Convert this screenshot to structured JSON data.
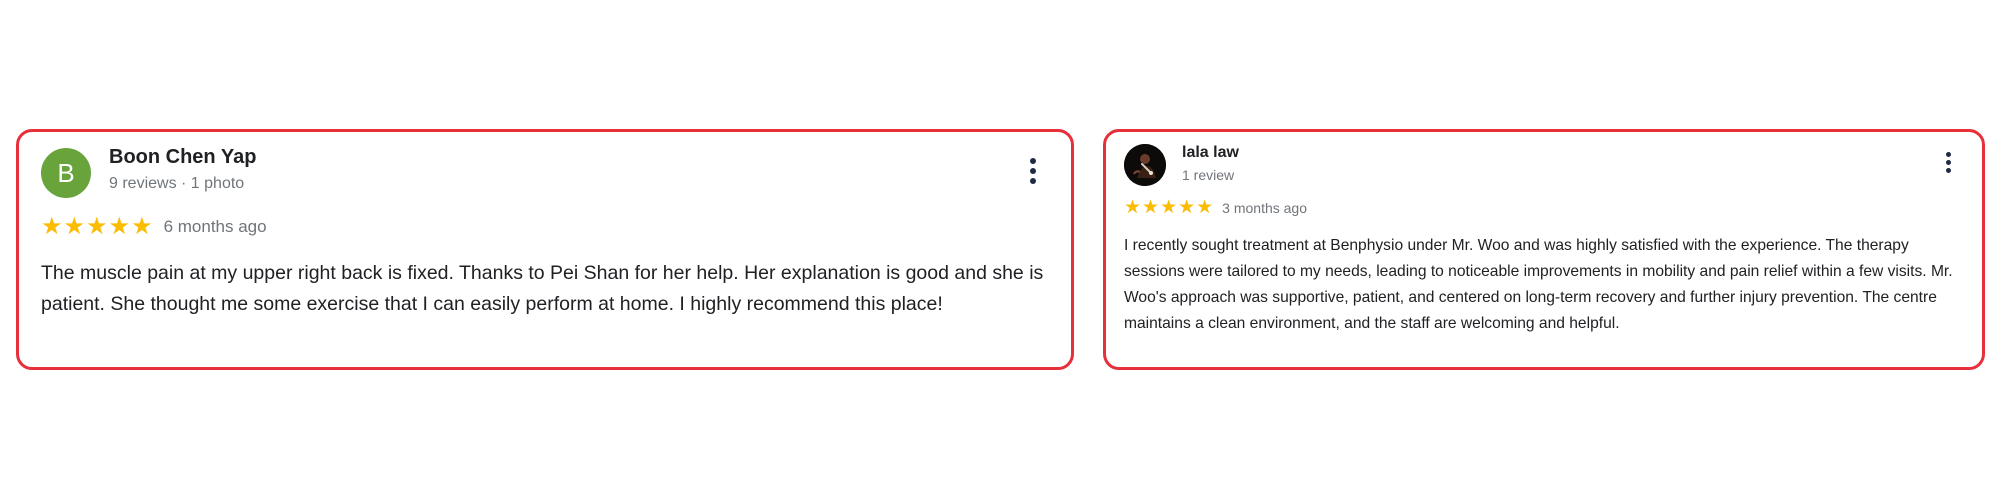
{
  "reviews": [
    {
      "avatar_letter": "B",
      "avatar_color": "#68a33c",
      "name": "Boon Chen Yap",
      "meta": "9 reviews · 1 photo",
      "rating": 5,
      "stars": "★★★★★",
      "date": "6 months ago",
      "text": "The muscle pain at my upper right back is fixed. Thanks to Pei Shan for her help. Her explanation is good and she is patient. She thought me some exercise that I can easily perform at home. I highly recommend this place!"
    },
    {
      "avatar_icon": "profile-photo-icon",
      "name": "lala law",
      "meta": "1 review",
      "rating": 5,
      "stars": "★★★★★",
      "date": "3 months ago",
      "text": "I recently sought treatment at Benphysio under Mr. Woo and was highly satisfied with the experience. The therapy sessions were tailored to my needs, leading to noticeable improvements in mobility and pain relief within a few visits. Mr. Woo's approach was supportive, patient, and centered on long-term recovery and further injury prevention. The centre maintains a clean environment, and the staff are welcoming and helpful."
    }
  ],
  "colors": {
    "card_border": "#e8303a",
    "star": "#fbbc04",
    "secondary_text": "#70757a"
  },
  "icons": {
    "more": "more-vert-icon",
    "star": "star-icon"
  }
}
